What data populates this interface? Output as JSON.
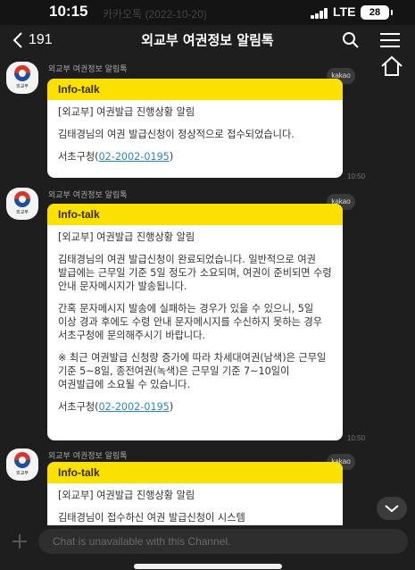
{
  "status_bar": {
    "time": "10:15",
    "ghost_text": "카카오톡 (2022-10-20)",
    "network": "LTE",
    "battery": "28"
  },
  "header": {
    "back_count": "191",
    "title": "외교부 여권정보 알림톡"
  },
  "channel": {
    "sender_name": "외교부 여권정보 알림톡",
    "avatar_label": "외교부"
  },
  "messages": [
    {
      "sender": "외교부 여권정보 알림톡",
      "header": "Info-talk",
      "badge": "kakao",
      "paragraphs": [
        "[외교부] 여권발급 진행상황 알림",
        "김태경님의 여권 발급신청이 정상적으로 접수되었습니다."
      ],
      "contact_prefix": "서초구청(",
      "contact_phone": "02-2002-0195",
      "contact_suffix": ")",
      "time": "10:50"
    },
    {
      "sender": "외교부 여권정보 알림톡",
      "header": "Info-talk",
      "badge": "kakao",
      "paragraphs": [
        "[외교부] 여권발급 진행상황 알림",
        "김태경님의 여권 발급신청이 완료되었습니다. 일반적으로 여권 발급에는 근무일 기준 5일 정도가 소요되며, 여권이 준비되면 수령 안내 문자메시지가 발송됩니다.",
        "간혹 문자메시지 발송에 실패하는 경우가 있을 수 있으니, 5일 이상 경과 후에도 수령 안내 문자메시지를 수신하지 못하는 경우 서초구청에 문의해주시기 바랍니다.",
        "※ 최근 여권발급 신청량 증가에 따라 차세대여권(남색)은 근무일 기준 5~8일, 종전여권(녹색)은 근무일 기준 7~10일이 여권발급에 소요될 수 있습니다."
      ],
      "contact_prefix": "서초구청(",
      "contact_phone": "02-2002-0195",
      "contact_suffix": ")",
      "time": "10:50"
    },
    {
      "sender": "외교부 여권정보 알림톡",
      "header": "Info-talk",
      "badge": "kakao",
      "paragraphs": [
        "[외교부] 여권발급 진행상황 알림",
        "김태경님이 접수하신 여권 발급신청이 시스템"
      ]
    }
  ],
  "input": {
    "placeholder": "Chat is unavailable with this Channel."
  },
  "colors": {
    "background": "#1e1e1e",
    "info_talk_header": "#fae100",
    "link": "#2a86c8"
  },
  "icons": [
    "chevron-left-icon",
    "search-icon",
    "menu-icon",
    "home-icon",
    "chevron-down-icon",
    "plus-icon",
    "emblem-icon"
  ]
}
